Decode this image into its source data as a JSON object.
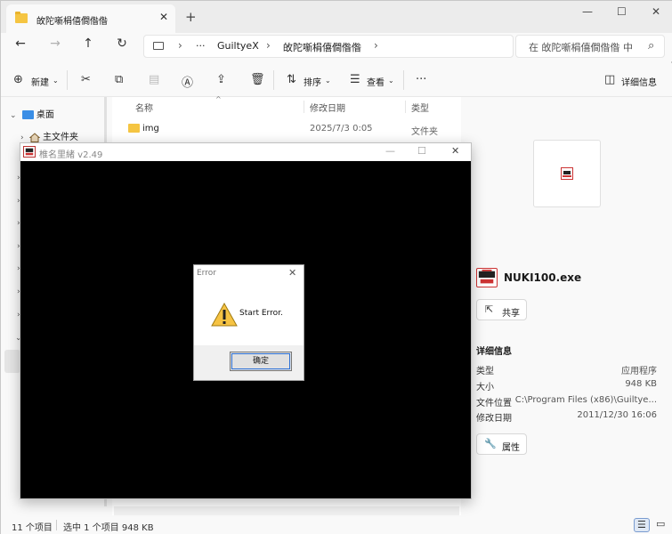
{
  "tab": {
    "title": "敀陀噺梋僖僴偺偺",
    "close": "✕",
    "new": "+"
  },
  "window_buttons": {
    "minimize": "—",
    "maximize": "☐",
    "close": "✕"
  },
  "nav": {
    "back": "←",
    "forward": "→",
    "up": "↑",
    "refresh": "↻"
  },
  "address": {
    "more": "···",
    "crumbs": [
      "GuiltyeX",
      "敀陀噺梋僖僴偺偺"
    ],
    "search_placeholder": "在 敀陀噺梋僖僴偺偺 中"
  },
  "toolbar": {
    "new_label": "新建",
    "sort_label": "排序",
    "view_label": "查看",
    "more": "···",
    "details_label": "详细信息"
  },
  "sidebar": {
    "items": [
      {
        "label": "桌面"
      },
      {
        "label": "主文件夹"
      }
    ]
  },
  "filelist": {
    "headers": {
      "name": "名称",
      "date": "修改日期",
      "type": "类型"
    },
    "rows": [
      {
        "name": "img",
        "date": "2025/7/3 0:05",
        "type": "文件夹"
      }
    ]
  },
  "details_pane": {
    "file_name": "NUKI100.exe",
    "share_label": "共享",
    "section_title": "详细信息",
    "properties": [
      {
        "key": "类型",
        "value": "应用程序"
      },
      {
        "key": "大小",
        "value": "948 KB"
      },
      {
        "key": "文件位置",
        "value": "C:\\Program Files (x86)\\Guiltye..."
      },
      {
        "key": "修改日期",
        "value": "2011/12/30 16:06"
      }
    ],
    "properties_button": "属性"
  },
  "status": {
    "count": "11 个项目",
    "selection": "选中 1 个项目  948 KB"
  },
  "game_window": {
    "title": "椎名里緒 v2.49"
  },
  "dialog": {
    "title": "Error",
    "message": "Start Error.",
    "ok_label": "确定"
  },
  "colors": {
    "accent": "#2a6fd6",
    "folder": "#f5c542",
    "desktop_icon": "#3a8ee6"
  }
}
